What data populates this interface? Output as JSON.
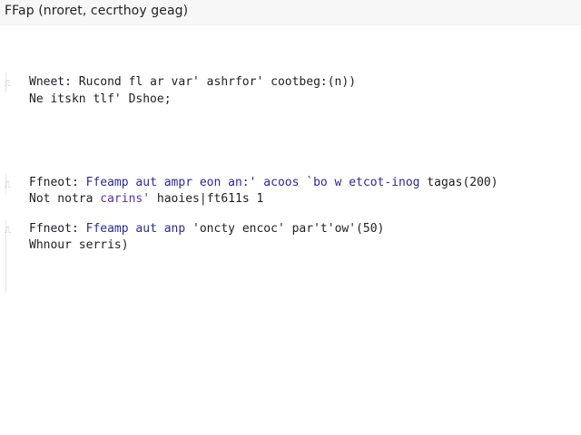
{
  "window": {
    "title": "FFap  (nroret, cecrthoy geag)"
  },
  "entries": [
    {
      "line1_prefix": "Wneet: ",
      "line1_body": "Rucond fl ar var' ashrfor' cootbeg:(n))",
      "line2": "Ne itskn tlf' Dshoe;"
    },
    {
      "line1_prefix": "Ffneot: ",
      "line1_highlight": "Ffeamp aut ampr eon an:' acoos `bo w etcot-inog",
      "line1_tail": " tagas(200)",
      "line2_prefix": "Not notra",
      "line2_highlight": " carins'",
      "line2_tail": " haoies|ft611s 1"
    },
    {
      "line1_prefix": "Ffneot: ",
      "line1_highlight": "Ffeamp aut anp",
      "line1_tail": " 'oncty encoc' par't'ow'(50)",
      "line2": "Whnour serris)"
    }
  ],
  "gutter": {
    "marks": [
      "⎍",
      "⎍",
      "⎍"
    ]
  }
}
